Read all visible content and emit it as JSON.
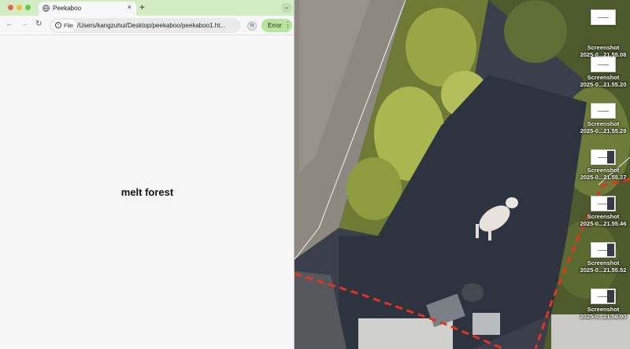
{
  "browser": {
    "tab_title": "Peekaboo",
    "tab_close": "×",
    "new_tab": "+",
    "tab_menu": "⌄",
    "nav": {
      "back": "←",
      "forward": "→",
      "reload": "↻"
    },
    "site_chip": "File",
    "info_icon": "i",
    "url": "/Users/kangzuhui/Desktop/peekaboo/peekaboo1.ht...",
    "bookmark_icon": "☆",
    "profile_initial": "N",
    "error_label": "Error",
    "menu_icon": "⋮"
  },
  "page": {
    "text": "melt forest"
  },
  "desktop": {
    "icons": [
      {
        "line1": "",
        "line2": ""
      },
      {
        "line1": "Screenshot",
        "line2": "2025-0...21.55.08"
      },
      {
        "line1": "Screenshot",
        "line2": "2025-0...21.55.20"
      },
      {
        "line1": "Screenshot",
        "line2": "2025-0...21.55.29"
      },
      {
        "line1": "Screenshot",
        "line2": "2025-0...21.55.37"
      },
      {
        "line1": "Screenshot",
        "line2": "2025-0...21.55.46"
      },
      {
        "line1": "Screenshot",
        "line2": "2025-0...21.55.52"
      },
      {
        "line1": "Screenshot",
        "line2": "2025-0...21.56.00"
      }
    ]
  },
  "colors": {
    "tab_strip": "#d4ecc4",
    "error_chip": "#b9e49e",
    "page_background": "#f7f7f7",
    "boundary_line": "#e3341f"
  }
}
